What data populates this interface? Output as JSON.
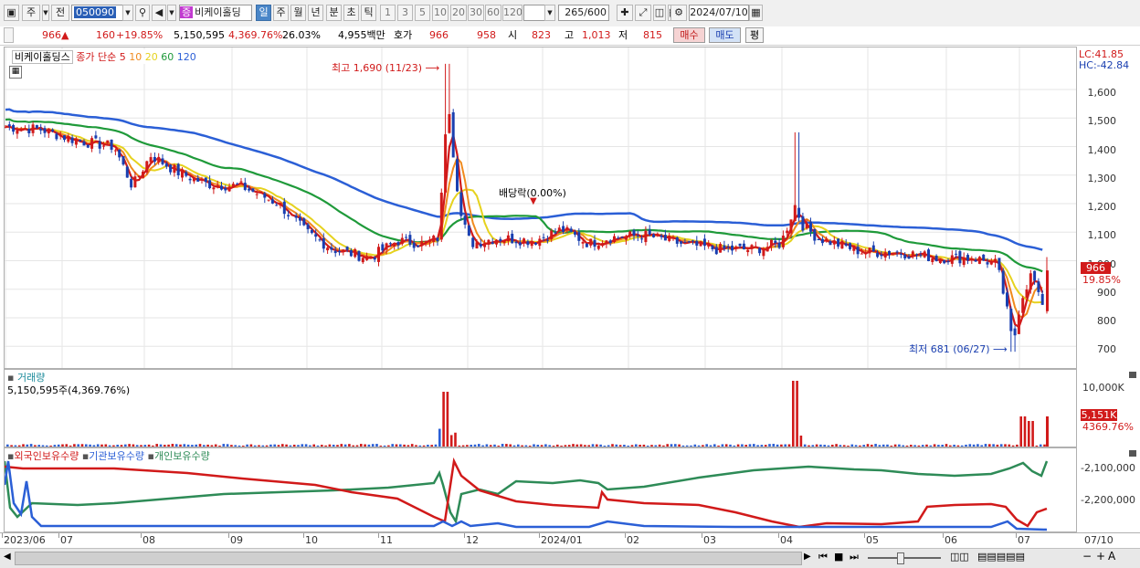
{
  "toolbar": {
    "market": "주",
    "prev": "전",
    "code": "050090",
    "stock_name": "비케이홀딩",
    "stock_tag": "증",
    "periods": [
      "일",
      "주",
      "월",
      "년",
      "분",
      "초",
      "틱"
    ],
    "selected_period": "일",
    "intervals": [
      "1",
      "3",
      "5",
      "10",
      "20",
      "30",
      "60",
      "120"
    ],
    "count": "265",
    "count_total": "/600",
    "date": "2024/07/10"
  },
  "quote": {
    "price": "966",
    "change_arrow": "▲",
    "change": "160",
    "change_pct": "+19.85%",
    "volume": "5,150,595",
    "volume_ratio": "4,369.76%",
    "turnover": "26.03%",
    "amount": "4,955백만",
    "hoga_label": "호가",
    "ask": "966",
    "bid": "958",
    "open_label": "시",
    "open": "823",
    "high_label": "고",
    "high": "1,013",
    "low_label": "저",
    "low": "815",
    "buy_button": "매수",
    "sell_button": "매도",
    "eval_button": "평"
  },
  "price_pane": {
    "stock_label": "비케이홀딩스",
    "ma_label": "종가 단순",
    "ma_periods": [
      {
        "value": "5",
        "color": "#d11a1a"
      },
      {
        "value": "10",
        "color": "#f08a1e"
      },
      {
        "value": "20",
        "color": "#e6d21e"
      },
      {
        "value": "60",
        "color": "#1f9a3a"
      },
      {
        "value": "120",
        "color": "#2b5fd6"
      }
    ],
    "lc": "LC:41.85",
    "hc": "HC:-42.84",
    "high_annotation": "최고 1,690 (11/23)",
    "dividend_annotation": "배당락(0.00%)",
    "low_annotation": "최저 681 (06/27)",
    "current_price_tag": "966",
    "current_pct_tag": "19.85%",
    "y_ticks": [
      "1,600",
      "1,500",
      "1,400",
      "1,300",
      "1,200",
      "1,100",
      "1,000",
      "900",
      "800",
      "700"
    ]
  },
  "volume_pane": {
    "title": "거래량",
    "value": "5,150,595주(4,369.76%)",
    "y_tick": "10,000K",
    "current_tag": "5,151K",
    "current_pct": "4369.76%"
  },
  "holdings_pane": {
    "labels": [
      {
        "text": "외국인보유수량",
        "color": "#d11a1a"
      },
      {
        "text": "기관보유수량",
        "color": "#2b5fd6"
      },
      {
        "text": "개인보유수량",
        "color": "#2e8b57"
      }
    ],
    "y_ticks": [
      "-2,100,000",
      "-2,200,000"
    ]
  },
  "x_axis": [
    "2023/06",
    "07",
    "08",
    "09",
    "10",
    "11",
    "12",
    "2024/01",
    "02",
    "03",
    "04",
    "05",
    "06",
    "07",
    "07/10"
  ]
}
